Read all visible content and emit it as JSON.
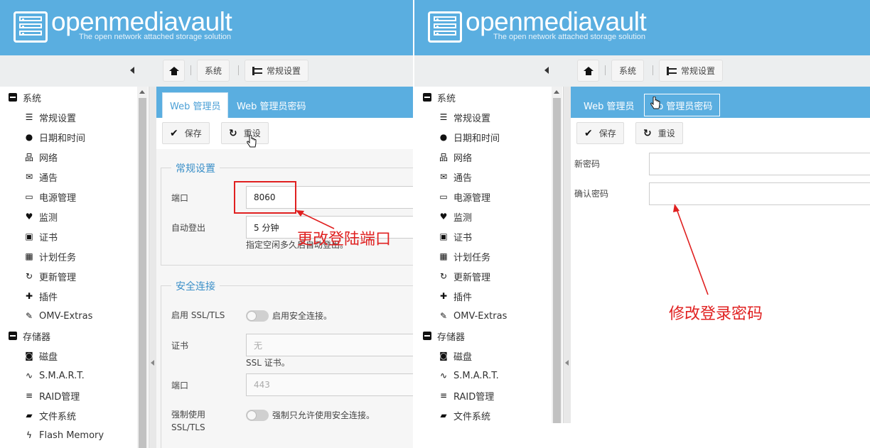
{
  "brand": {
    "name": "openmediavault",
    "tagline": "The open network attached storage solution"
  },
  "breadcrumb": {
    "system": "系统",
    "general": "常规设置"
  },
  "sidebar": {
    "items": [
      {
        "label": "系统",
        "icon": "minus-box-icon",
        "level": 0
      },
      {
        "label": "常规设置",
        "icon": "sliders-icon",
        "level": 1
      },
      {
        "label": "日期和时间",
        "icon": "clock-icon",
        "level": 1
      },
      {
        "label": "网络",
        "icon": "network-icon",
        "level": 1
      },
      {
        "label": "通告",
        "icon": "envelope-icon",
        "level": 1
      },
      {
        "label": "电源管理",
        "icon": "battery-icon",
        "level": 1
      },
      {
        "label": "监测",
        "icon": "heartbeat-icon",
        "level": 1
      },
      {
        "label": "证书",
        "icon": "certificate-icon",
        "level": 1
      },
      {
        "label": "计划任务",
        "icon": "calendar-clock-icon",
        "level": 1
      },
      {
        "label": "更新管理",
        "icon": "refresh-icon",
        "level": 1
      },
      {
        "label": "插件",
        "icon": "puzzle-icon",
        "level": 1
      },
      {
        "label": "OMV-Extras",
        "icon": "plug-icon",
        "level": 1
      },
      {
        "label": "存储器",
        "icon": "minus-box-icon",
        "level": 0
      },
      {
        "label": "磁盘",
        "icon": "disk-icon",
        "level": 1
      },
      {
        "label": "S.M.A.R.T.",
        "icon": "pulse-icon",
        "level": 1
      },
      {
        "label": "RAID管理",
        "icon": "database-icon",
        "level": 1
      },
      {
        "label": "文件系统",
        "icon": "folder-icon",
        "level": 1
      },
      {
        "label": "Flash Memory",
        "icon": "bolt-icon",
        "level": 1
      }
    ]
  },
  "tabs": {
    "admin": "Web 管理员",
    "password": "Web 管理员密码"
  },
  "tabs_right_password_visible": "b 管理员密码",
  "actions": {
    "save": "保存",
    "reset": "重设"
  },
  "general": {
    "legend": "常规设置",
    "port_label": "端口",
    "port_value": "8060",
    "autologout_label": "自动登出",
    "autologout_value": "5 分钟",
    "autologout_hint": "指定空闲多久后自动登出。"
  },
  "secure": {
    "legend": "安全连接",
    "ssl_label": "启用 SSL/TLS",
    "ssl_toggle_text": "启用安全连接。",
    "cert_label": "证书",
    "cert_value": "无",
    "cert_hint": "SSL 证书。",
    "port_label": "端口",
    "port_value": "443",
    "force_label_1": "强制使用",
    "force_label_2": "SSL/TLS",
    "force_toggle_text": "强制只允许使用安全连接。"
  },
  "password_form": {
    "new_label": "新密码",
    "confirm_label": "确认密码"
  },
  "annotations": {
    "left": "更改登陆端口",
    "right": "修改登录密码"
  },
  "colors": {
    "header": "#5aaee0",
    "annotation": "#e02020",
    "legend": "#3a8fc8"
  }
}
